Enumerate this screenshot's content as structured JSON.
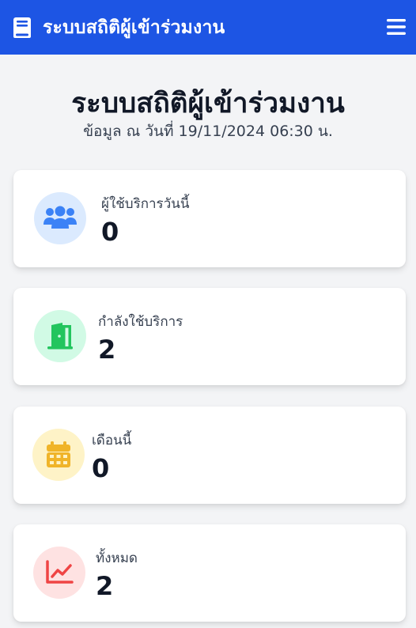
{
  "navbar": {
    "title": "ระบบสถิติผู้เข้าร่วมงาน",
    "brand_icon": "book-icon",
    "menu_icon": "hamburger-menu-icon"
  },
  "page": {
    "title": "ระบบสถิติผู้เข้าร่วมงาน",
    "subtitle": "ข้อมูล ณ วันที่ 19/11/2024 06:30 น."
  },
  "stats": [
    {
      "label": "ผู้ใช้บริการวันนี้",
      "value": "0",
      "icon": "users-icon",
      "icon_color": "#3b82f6",
      "icon_bg": "#dbeafe"
    },
    {
      "label": "กำลังใช้บริการ",
      "value": "2",
      "icon": "door-open-icon",
      "icon_color": "#22c55e",
      "icon_bg": "#d1fae5"
    },
    {
      "label": "เดือนนี้",
      "value": "0",
      "icon": "calendar-icon",
      "icon_color": "#f0b429",
      "icon_bg": "#fef3c7"
    },
    {
      "label": "ทั้งหมด",
      "value": "2",
      "icon": "chart-line-icon",
      "icon_color": "#ef4444",
      "icon_bg": "#fee2e2"
    }
  ],
  "colors": {
    "primary": "#1d55e4",
    "background": "#f3f4f6"
  }
}
